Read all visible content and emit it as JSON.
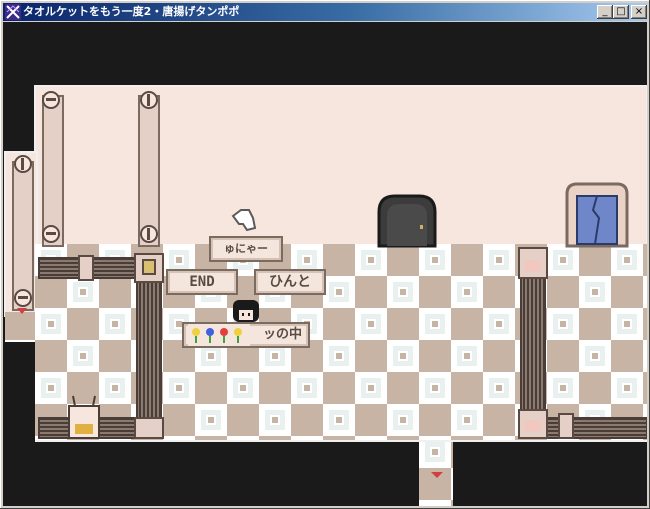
{
  "window": {
    "title": "タオルケットをもう一度2・唐揚げタンポポ",
    "controls": {
      "minimize": "_",
      "maximize": "□",
      "close": "×"
    }
  },
  "game": {
    "signs": {
      "meow": "ゅにゃー",
      "end": "END",
      "hint": "ひんと",
      "inside": "ッの中"
    },
    "icons": [
      "pointing-hand-icon",
      "flower-icon",
      "arrow-down-icon"
    ],
    "colors": {
      "wall": "#f6e6de",
      "floor_tan": "#c8b4a4",
      "floor_white": "#ffffff",
      "background": "#1a1a1a",
      "door_dark": "#3c3c3c",
      "door_blue": "#6f87c9",
      "accent_red": "#d04040"
    }
  }
}
